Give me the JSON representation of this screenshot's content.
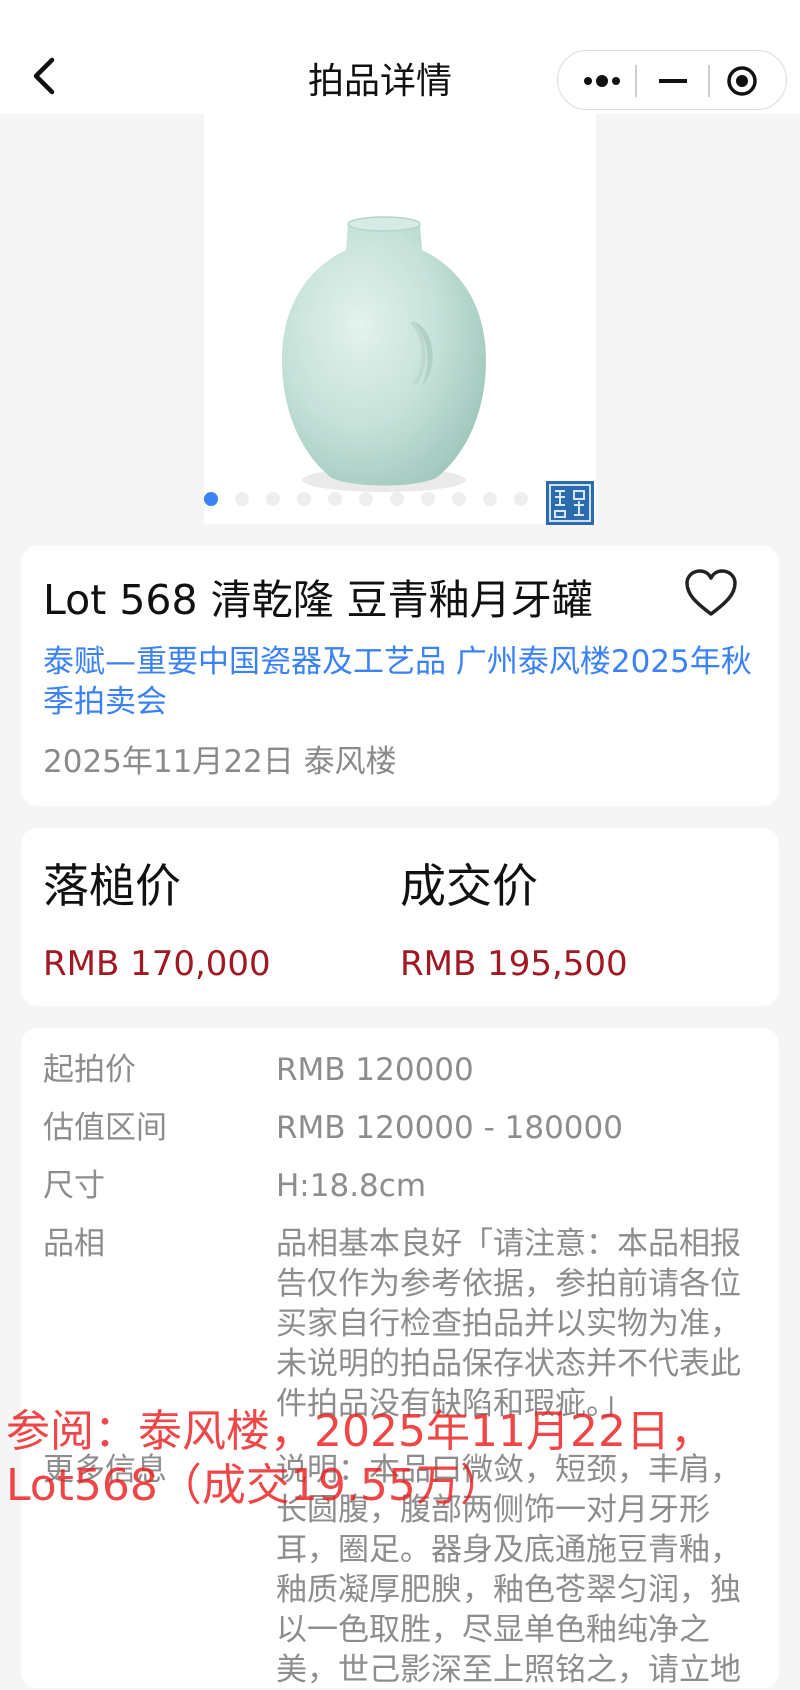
{
  "header": {
    "title": "拍品详情",
    "back_icon": "chevron-left-icon",
    "menu_icon": "more-dots-icon",
    "minimize_icon": "minimize-icon",
    "close_icon": "target-icon"
  },
  "gallery": {
    "total_images": 12,
    "current_index": 1,
    "indicator_active_color": "#3b82f6"
  },
  "lot": {
    "title": "Lot 568 清乾隆 豆青釉月牙罐",
    "sale_name": "泰赋—重要中国瓷器及工艺品 广州泰风楼2025年秋季拍卖会",
    "date_place": "2025年11月22日 泰风楼",
    "favorite_icon": "heart-outline-icon"
  },
  "prices": {
    "hammer_label": "落槌价",
    "hammer_value": "RMB 170,000",
    "deal_label": "成交价",
    "deal_value": "RMB 195,500",
    "price_color": "#a01822"
  },
  "info": [
    {
      "label": "起拍价",
      "value": "RMB 120000"
    },
    {
      "label": "估值区间",
      "value": "RMB 120000 - 180000"
    },
    {
      "label": "尺寸",
      "value": "H:18.8cm"
    },
    {
      "label": "品相",
      "value": "品相基本良好「请注意：本品相报告仅作为参考依据，参拍前请各位买家自行检查拍品并以实物为准，未说明的拍品保存状态并不代表此件拍品没有缺陷和瑕疵。」"
    },
    {
      "label": "更多信息",
      "value": "说明：本品口微敛，短颈，丰肩，长圆腹，腹部两侧饰一对月牙形耳，圈足。器身及底通施豆青釉，釉质凝厚肥腴，釉色苍翠匀润，独以一色取胜，尽显单色釉纯净之美，世己影深至上照铭之，请立地"
    }
  ],
  "watermark": {
    "line1": "参阅：泰风楼，2025年11月22日，",
    "line2": "Lot568（成交19.55万）"
  }
}
